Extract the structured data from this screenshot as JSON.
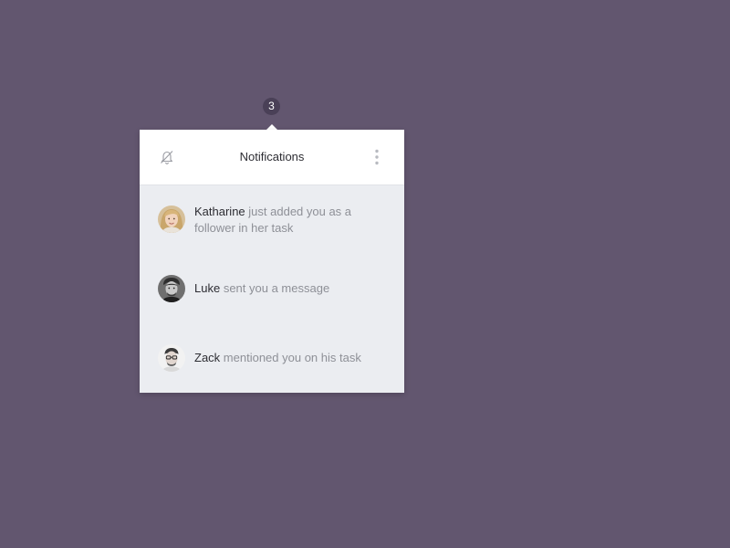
{
  "badge": {
    "count": "3"
  },
  "panel": {
    "title": "Notifications",
    "mute_icon": "bell-slash-icon",
    "more_icon": "vertical-ellipsis-icon"
  },
  "notifications": [
    {
      "name": "Katharine",
      "message": "just added you as a follower in her task",
      "avatar": "avatar-katharine"
    },
    {
      "name": "Luke",
      "message": "sent you a message",
      "avatar": "avatar-luke"
    },
    {
      "name": "Zack",
      "message": "mentioned you on his task",
      "avatar": "avatar-zack"
    }
  ],
  "colors": {
    "background": "#62566f",
    "panel_body": "#ebedf1",
    "panel_header": "#ffffff",
    "name_text": "#2d2d33",
    "message_text": "#8e9097",
    "badge": "#4a4057"
  }
}
